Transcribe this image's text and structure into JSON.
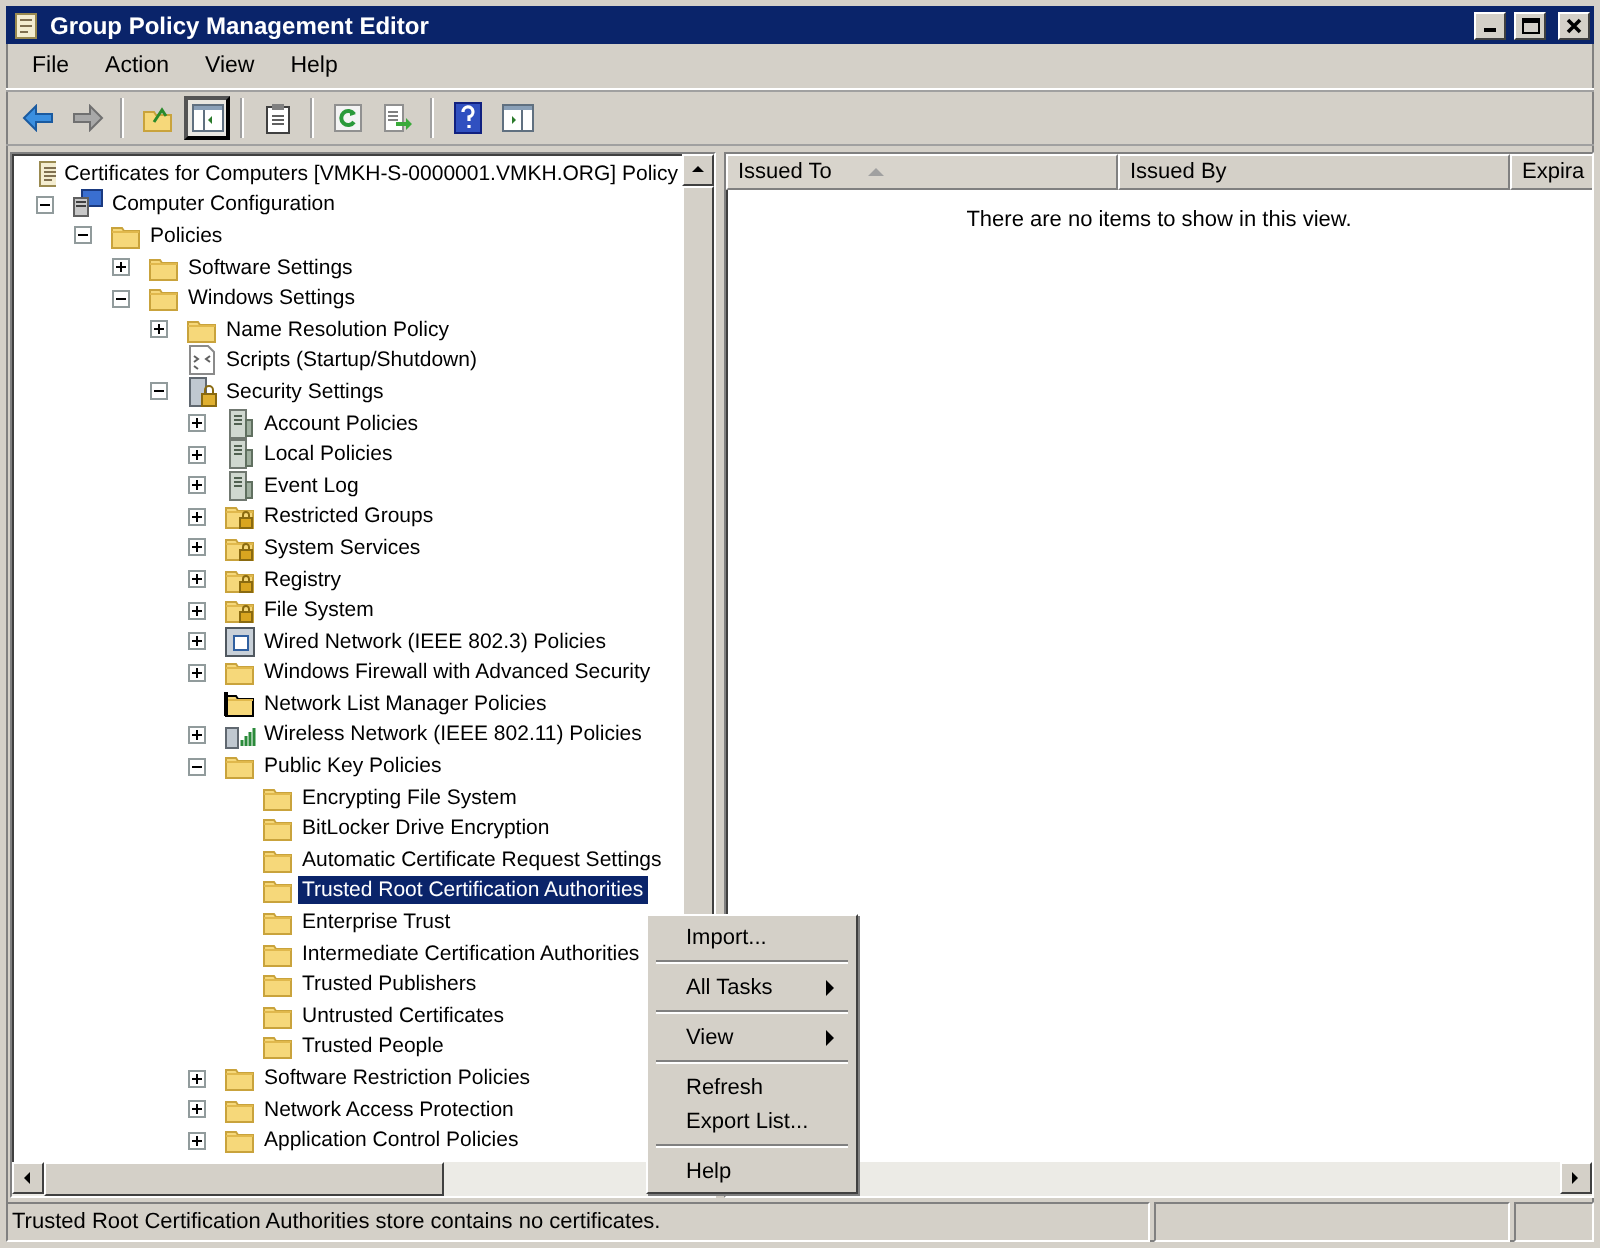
{
  "window": {
    "title": "Group Policy Management Editor"
  },
  "menu": [
    "File",
    "Action",
    "View",
    "Help"
  ],
  "toolbar": {
    "back_enabled": true,
    "forward_enabled": false,
    "console_tree_shown": true
  },
  "tree": [
    {
      "label": "Certificates for Computers [VMKH-S-0000001.VMKH.ORG] Policy",
      "kind": "document",
      "selected": false,
      "children": [
        {
          "label": "Computer Configuration",
          "kind": "computer",
          "selected": false,
          "expanded": true,
          "children": [
            {
              "label": "Policies",
              "kind": "folder",
              "selected": false,
              "expanded": true,
              "children": [
                {
                  "label": "Software Settings",
                  "kind": "folder",
                  "selected": false,
                  "expanded": false
                },
                {
                  "label": "Windows Settings",
                  "kind": "folder",
                  "selected": false,
                  "expanded": true,
                  "children": [
                    {
                      "label": "Name Resolution Policy",
                      "kind": "folder",
                      "selected": false,
                      "expanded": false
                    },
                    {
                      "label": "Scripts (Startup/Shutdown)",
                      "kind": "script",
                      "selected": false
                    },
                    {
                      "label": "Security Settings",
                      "kind": "secure-server",
                      "selected": false,
                      "expanded": true,
                      "children": [
                        {
                          "label": "Account Policies",
                          "kind": "server",
                          "selected": false,
                          "expanded": false
                        },
                        {
                          "label": "Local Policies",
                          "kind": "server",
                          "selected": false,
                          "expanded": false
                        },
                        {
                          "label": "Event Log",
                          "kind": "server",
                          "selected": false,
                          "expanded": false
                        },
                        {
                          "label": "Restricted Groups",
                          "kind": "lock-folder",
                          "selected": false,
                          "expanded": false
                        },
                        {
                          "label": "System Services",
                          "kind": "lock-folder",
                          "selected": false,
                          "expanded": false
                        },
                        {
                          "label": "Registry",
                          "kind": "lock-folder",
                          "selected": false,
                          "expanded": false
                        },
                        {
                          "label": "File System",
                          "kind": "lock-folder",
                          "selected": false,
                          "expanded": false
                        },
                        {
                          "label": "Wired Network (IEEE 802.3) Policies",
                          "kind": "network",
                          "selected": false,
                          "expanded": false
                        },
                        {
                          "label": "Windows Firewall with Advanced Security",
                          "kind": "folder",
                          "selected": false,
                          "expanded": false
                        },
                        {
                          "label": "Network List Manager Policies",
                          "kind": "dark-folder",
                          "selected": false
                        },
                        {
                          "label": "Wireless Network (IEEE 802.11) Policies",
                          "kind": "wireless",
                          "selected": false,
                          "expanded": false
                        },
                        {
                          "label": "Public Key Policies",
                          "kind": "folder",
                          "selected": false,
                          "expanded": true,
                          "children": [
                            {
                              "label": "Encrypting File System",
                              "kind": "folder",
                              "selected": false
                            },
                            {
                              "label": "BitLocker Drive Encryption",
                              "kind": "folder",
                              "selected": false
                            },
                            {
                              "label": "Automatic Certificate Request Settings",
                              "kind": "folder",
                              "selected": false
                            },
                            {
                              "label": "Trusted Root Certification Authorities",
                              "kind": "folder",
                              "selected": true
                            },
                            {
                              "label": "Enterprise Trust",
                              "kind": "folder",
                              "selected": false
                            },
                            {
                              "label": "Intermediate Certification Authorities",
                              "kind": "folder",
                              "selected": false
                            },
                            {
                              "label": "Trusted Publishers",
                              "kind": "folder",
                              "selected": false
                            },
                            {
                              "label": "Untrusted Certificates",
                              "kind": "folder",
                              "selected": false
                            },
                            {
                              "label": "Trusted People",
                              "kind": "folder",
                              "selected": false
                            }
                          ]
                        },
                        {
                          "label": "Software Restriction Policies",
                          "kind": "folder",
                          "selected": false,
                          "expanded": false
                        },
                        {
                          "label": "Network Access Protection",
                          "kind": "folder",
                          "selected": false,
                          "expanded": false
                        },
                        {
                          "label": "Application Control Policies",
                          "kind": "folder",
                          "selected": false,
                          "expanded": false
                        }
                      ]
                    }
                  ]
                }
              ]
            }
          ]
        }
      ]
    }
  ],
  "list": {
    "columns": [
      {
        "label": "Issued To",
        "sorted": true
      },
      {
        "label": "Issued By"
      },
      {
        "label": "Expira"
      }
    ],
    "empty_message": "There are no items to show in this view."
  },
  "context_menu": [
    {
      "kind": "item",
      "label": "Import..."
    },
    {
      "kind": "separator"
    },
    {
      "kind": "submenu",
      "label": "All Tasks"
    },
    {
      "kind": "separator"
    },
    {
      "kind": "submenu",
      "label": "View"
    },
    {
      "kind": "separator"
    },
    {
      "kind": "item",
      "label": "Refresh"
    },
    {
      "kind": "item",
      "label": "Export List..."
    },
    {
      "kind": "separator"
    },
    {
      "kind": "item",
      "label": "Help"
    }
  ],
  "status_bar": {
    "text": "Trusted Root Certification Authorities store contains no certificates."
  }
}
